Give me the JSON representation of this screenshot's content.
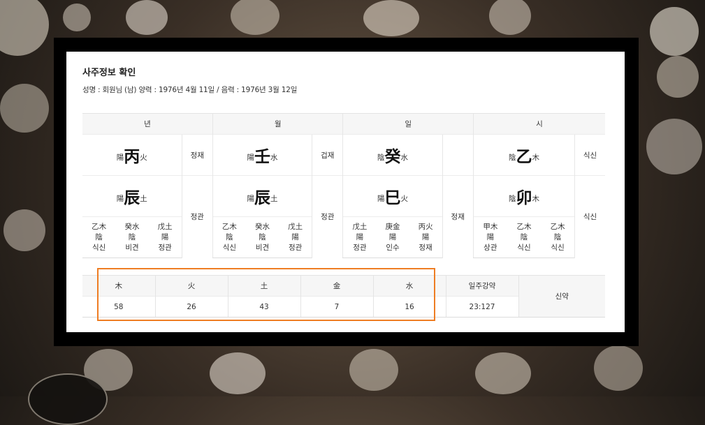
{
  "title": "사주정보 확인",
  "info": "성명 : 회원님 (남)   양력 : 1976년 4월 11일 / 음력 : 1976년 3월 12일",
  "pillars": [
    {
      "header": "년",
      "stem": {
        "yy": "陽",
        "char": "丙",
        "el": "火"
      },
      "stem_god": "정재",
      "branch": {
        "yy": "陽",
        "char": "辰",
        "el": "土"
      },
      "branch_god": "정관",
      "hidden": [
        {
          "stem": "乙木",
          "yy": "陰",
          "god": "식신"
        },
        {
          "stem": "癸水",
          "yy": "陰",
          "god": "비견"
        },
        {
          "stem": "戊土",
          "yy": "陽",
          "god": "정관"
        }
      ]
    },
    {
      "header": "월",
      "stem": {
        "yy": "陽",
        "char": "壬",
        "el": "水"
      },
      "stem_god": "겁재",
      "branch": {
        "yy": "陽",
        "char": "辰",
        "el": "土"
      },
      "branch_god": "정관",
      "hidden": [
        {
          "stem": "乙木",
          "yy": "陰",
          "god": "식신"
        },
        {
          "stem": "癸水",
          "yy": "陰",
          "god": "비견"
        },
        {
          "stem": "戊土",
          "yy": "陽",
          "god": "정관"
        }
      ]
    },
    {
      "header": "일",
      "stem": {
        "yy": "陰",
        "char": "癸",
        "el": "水"
      },
      "stem_god": "",
      "branch": {
        "yy": "陽",
        "char": "巳",
        "el": "火"
      },
      "branch_god": "정재",
      "hidden": [
        {
          "stem": "戊土",
          "yy": "陽",
          "god": "정관"
        },
        {
          "stem": "庚金",
          "yy": "陽",
          "god": "인수"
        },
        {
          "stem": "丙火",
          "yy": "陽",
          "god": "정재"
        }
      ]
    },
    {
      "header": "시",
      "stem": {
        "yy": "陰",
        "char": "乙",
        "el": "木"
      },
      "stem_god": "식신",
      "branch": {
        "yy": "陰",
        "char": "卯",
        "el": "木"
      },
      "branch_god": "식신",
      "hidden": [
        {
          "stem": "甲木",
          "yy": "陽",
          "god": "상관"
        },
        {
          "stem": "乙木",
          "yy": "陰",
          "god": "식신"
        },
        {
          "stem": "乙木",
          "yy": "陰",
          "god": "식신"
        }
      ]
    }
  ],
  "ohang": {
    "headers": [
      "木",
      "火",
      "土",
      "金",
      "水"
    ],
    "values": [
      "58",
      "26",
      "43",
      "7",
      "16"
    ],
    "strength_header": "일주강약",
    "strength_value": "23:127",
    "result": "신약"
  },
  "colors": {
    "highlight": "#ee7d23"
  }
}
